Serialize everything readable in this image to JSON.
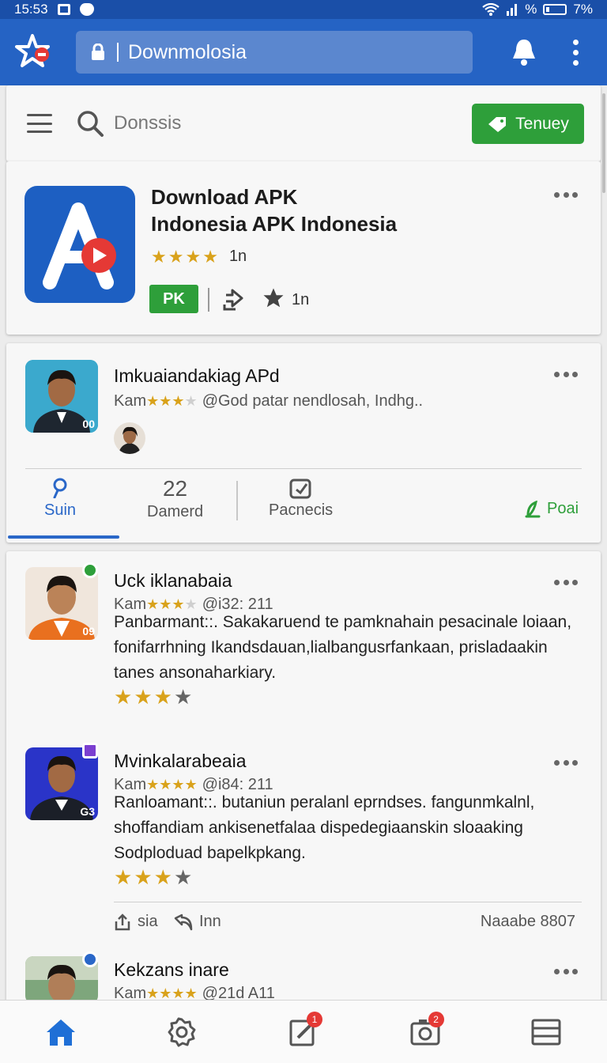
{
  "status_bar": {
    "time": "15:53",
    "battery": "7%",
    "signal_text": "%"
  },
  "app_bar": {
    "url": "Downmolosia"
  },
  "search_bar": {
    "placeholder": "Donssis",
    "button_label": "Tenuey"
  },
  "app_card": {
    "title_line1": "Download APK",
    "title_line2": "Indonesia APK Indonesia",
    "rating": 4,
    "rating_count": "1n",
    "badge": "PK",
    "likes": "1n"
  },
  "review_card_1": {
    "name": "Imkuaiandakiag APd",
    "meta_prefix": "Kam",
    "meta_text": "@God patar nendlosah, Indhg..",
    "avatar_label": "00",
    "tabs": [
      {
        "icon": "pin-icon",
        "label": "Suin"
      },
      {
        "number": "22",
        "label": "Damerd"
      },
      {
        "icon": "edit-icon",
        "label": "Pacnecis"
      },
      {
        "icon": "leaf-icon",
        "label": "Poai"
      }
    ]
  },
  "reviews": [
    {
      "name": "Uck iklanabaia",
      "meta_prefix": "Kam",
      "meta_text": "@i32: 211",
      "avatar_label": "09",
      "body": "Panbarmant::. Sakakaruend te pamknahain pesacinale loiaan, fonifarrhning Ikandsdauan,lialbangusrfankaan, prisladaakin tanes ansonaharkiary.",
      "rating": 3
    },
    {
      "name": "Mvinkalarabeaia",
      "meta_prefix": "Kam",
      "meta_text": "@i84: 211",
      "avatar_label": "G3",
      "body": "Ranloamant::. butaniun peralanl eprndses. fangunmkalnl, shoffandiam ankisenetfalaa dispedegiaanskin sloaaking Sodploduad bapelkpkang.",
      "rating": 3,
      "actions": {
        "share": "sia",
        "comment": "Inn",
        "count": "Naaabe 8807"
      }
    },
    {
      "name": "Kekzans inare",
      "meta_prefix": "Kam",
      "meta_text": "@21d A11"
    }
  ],
  "colors": {
    "primary": "#2563c4",
    "status": "#1a4fa8",
    "green": "#2e9f3a",
    "star": "#d9a21b",
    "badge": "#e53935"
  },
  "bottom_nav": [
    {
      "icon": "home-icon"
    },
    {
      "icon": "settings-icon"
    },
    {
      "icon": "edit-icon",
      "badge": "1"
    },
    {
      "icon": "camera-icon",
      "badge": "2"
    },
    {
      "icon": "list-icon"
    }
  ]
}
